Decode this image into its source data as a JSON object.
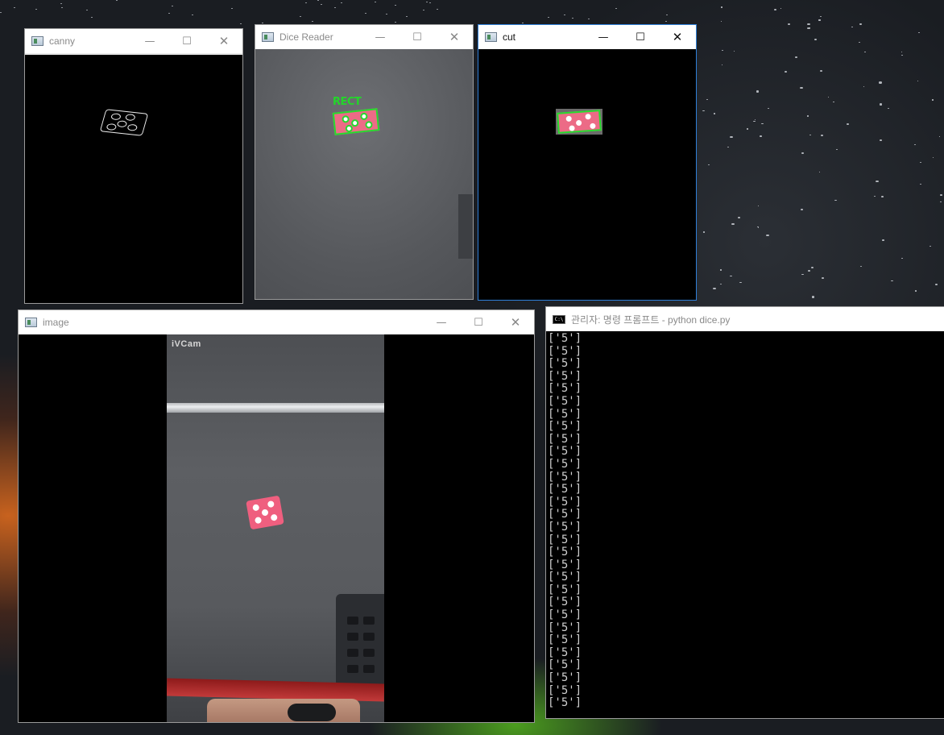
{
  "windows": {
    "canny": {
      "title": "canny"
    },
    "dice_reader": {
      "title": "Dice Reader",
      "rect_label": "RECT"
    },
    "cut": {
      "title": "cut"
    },
    "image": {
      "title": "image",
      "overlay_label": "iVCam"
    },
    "console": {
      "title": "관리자: 명령 프롬프트 - python  dice.py",
      "lines": [
        "['5']",
        "['5']",
        "['5']",
        "['5']",
        "['5']",
        "['5']",
        "['5']",
        "['5']",
        "['5']",
        "['5']",
        "['5']",
        "['5']",
        "['5']",
        "['5']",
        "['5']",
        "['5']",
        "['5']",
        "['5']",
        "['5']",
        "['5']",
        "['5']",
        "['5']",
        "['5']",
        "['5']",
        "['5']",
        "['5']",
        "['5']",
        "['5']",
        "['5']",
        "['5']"
      ]
    }
  },
  "controls": {
    "minimize": "—",
    "maximize": "☐",
    "close": "✕"
  },
  "colors": {
    "die_pink": "#ec6b86",
    "detection_green": "#25dc2e",
    "active_border": "#2f7fd8"
  }
}
